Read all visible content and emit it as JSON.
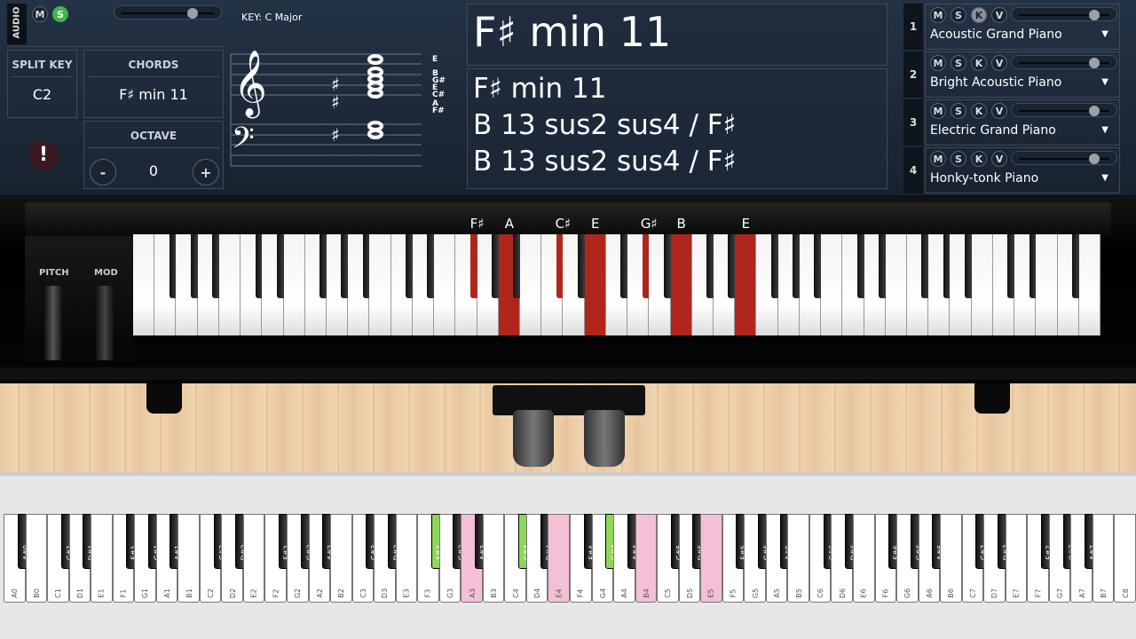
{
  "audio": {
    "label": "AUDIO",
    "mute": "M",
    "solo": "S",
    "volume": 0.8,
    "solo_color": "#3fb54a"
  },
  "split_key": {
    "label": "SPLIT KEY",
    "value": "C2"
  },
  "chords": {
    "label": "CHORDS",
    "value": "F♯ min 11"
  },
  "octave": {
    "label": "OCTAVE",
    "value": "0",
    "minus": "-",
    "plus": "+"
  },
  "warning_icon": "exclamation-icon",
  "key": "KEY: C Major",
  "staff": {
    "note_labels": [
      "E",
      "B",
      "G#",
      "E",
      "C#",
      "A",
      "F#"
    ]
  },
  "chord_display": {
    "main": "F♯ min 11",
    "alternatives": [
      "F♯ min 11",
      "B 13 sus2 sus4 / F♯",
      "B 13 sus2 sus4 / F♯"
    ]
  },
  "instruments": [
    {
      "num": "1",
      "name": "Acoustic Grand Piano",
      "buttons": [
        "M",
        "S",
        "K",
        "V"
      ],
      "k_active": true,
      "volume": 0.82
    },
    {
      "num": "2",
      "name": "Bright Acoustic Piano",
      "buttons": [
        "M",
        "S",
        "K",
        "V"
      ],
      "k_active": false,
      "volume": 0.82
    },
    {
      "num": "3",
      "name": "Electric Grand Piano",
      "buttons": [
        "M",
        "S",
        "K",
        "V"
      ],
      "k_active": false,
      "volume": 0.82
    },
    {
      "num": "4",
      "name": "Honky-tonk Piano",
      "buttons": [
        "M",
        "S",
        "K",
        "V"
      ],
      "k_active": false,
      "volume": 0.82
    }
  ],
  "wheels": {
    "pitch": "PITCH",
    "mod": "MOD"
  },
  "main_keyboard": {
    "first_key": "E1",
    "white_count": 45,
    "pressed_color": "#b0261c",
    "pressed": [
      {
        "note": "F#3",
        "label": "F♯"
      },
      {
        "note": "A3",
        "label": "A"
      },
      {
        "note": "C#4",
        "label": "C♯"
      },
      {
        "note": "E4",
        "label": "E"
      },
      {
        "note": "G#4",
        "label": "G♯"
      },
      {
        "note": "B4",
        "label": "B"
      },
      {
        "note": "E5",
        "label": "E"
      }
    ]
  },
  "bottom_keyboard": {
    "white_labels": [
      "A0",
      "B0",
      "C1",
      "D1",
      "E1",
      "F1",
      "G1",
      "A1",
      "B1",
      "C2",
      "D2",
      "E2",
      "F2",
      "G2",
      "A2",
      "B2",
      "C3",
      "D3",
      "E3",
      "F3",
      "G3",
      "A3",
      "B3",
      "C4",
      "D4",
      "E4",
      "F4",
      "G4",
      "A4",
      "B4",
      "C5",
      "D5",
      "E5",
      "F5",
      "G5",
      "A5",
      "B5",
      "C6",
      "D6",
      "E6",
      "F6",
      "G6",
      "A6",
      "B6",
      "C7",
      "D7",
      "E7",
      "F7",
      "G7",
      "A7",
      "B7",
      "C8"
    ],
    "green_keys": [
      "F#3",
      "C#4",
      "G#4"
    ],
    "pink_keys": [
      "A3",
      "E4",
      "B4",
      "E5"
    ],
    "green_color": "#8fd65a",
    "pink_color": "#f5bfd8"
  }
}
